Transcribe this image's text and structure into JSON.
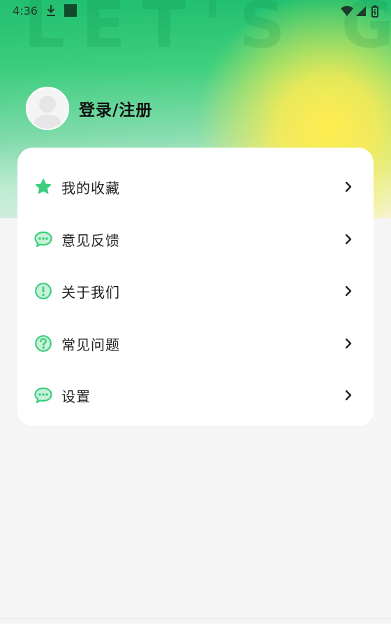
{
  "status_bar": {
    "time": "4:36",
    "icons": [
      "download-icon",
      "app-square-icon",
      "wifi-icon",
      "signal-icon",
      "battery-icon"
    ]
  },
  "header": {
    "watermark_text": "LET'S GO",
    "login_label": "登录/注册"
  },
  "menu": {
    "items": [
      {
        "label": "我的收藏",
        "icon": "star-icon"
      },
      {
        "label": "意见反馈",
        "icon": "chat-icon"
      },
      {
        "label": "关于我们",
        "icon": "info-exclamation-icon"
      },
      {
        "label": "常见问题",
        "icon": "question-icon"
      },
      {
        "label": "设置",
        "icon": "chat-icon"
      }
    ]
  },
  "colors": {
    "accent_green": "#3ccf7f",
    "gradient_yellow": "#ffec50",
    "card_bg": "#ffffff",
    "page_bg": "#f5f5f5"
  }
}
